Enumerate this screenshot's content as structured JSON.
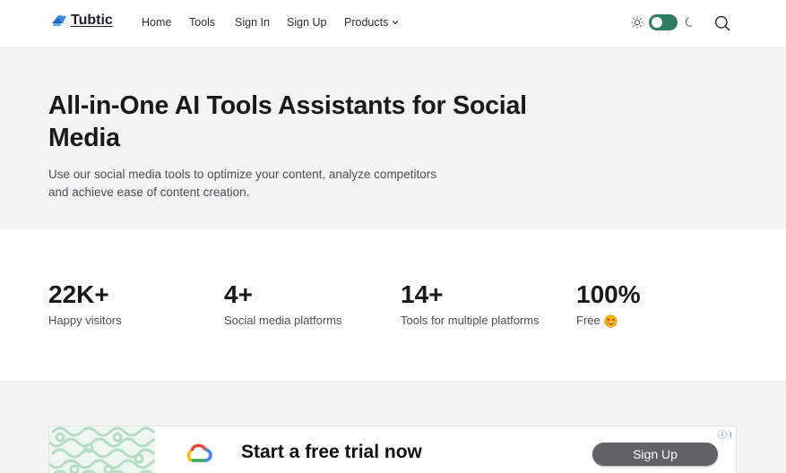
{
  "header": {
    "logo_text": "Tubtic",
    "nav": {
      "home": "Home",
      "tools": "Tools",
      "sign_in": "Sign In",
      "sign_up": "Sign Up",
      "products": "Products"
    },
    "theme_toggle_on": true
  },
  "hero": {
    "title": "All-in-One AI Tools Assistants for Social Media",
    "subtitle": "Use our social media tools to optimize your content, analyze competitors and achieve ease of content creation."
  },
  "stats": [
    {
      "value": "22K+",
      "label": "Happy visitors"
    },
    {
      "value": "4+",
      "label": "Social media platforms"
    },
    {
      "value": "14+",
      "label": "Tools for multiple platforms"
    },
    {
      "value": "100%",
      "label": "Free"
    }
  ],
  "ad": {
    "headline": "Start a free trial now",
    "button_label": "Sign Up",
    "info_glyph": "ⓘ ⁝"
  },
  "colors": {
    "accent": "#2f7d61",
    "hero_bg": "#f4f4f4",
    "ad_button": "#5f6368"
  }
}
